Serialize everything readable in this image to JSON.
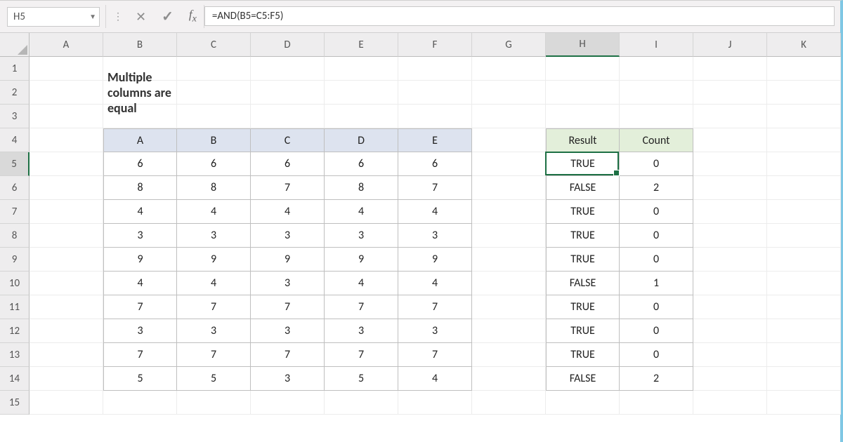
{
  "namebox": {
    "value": "H5"
  },
  "formula": "=AND(B5=C5:F5)",
  "columns": [
    "A",
    "B",
    "C",
    "D",
    "E",
    "F",
    "G",
    "H",
    "I",
    "J",
    "K"
  ],
  "rows": [
    "1",
    "2",
    "3",
    "4",
    "5",
    "6",
    "7",
    "8",
    "9",
    "10",
    "11",
    "12",
    "13",
    "14",
    "15"
  ],
  "active": {
    "col": "H",
    "row": "5"
  },
  "title": "Multiple columns are equal",
  "table1": {
    "headers": [
      "A",
      "B",
      "C",
      "D",
      "E"
    ],
    "rows": [
      [
        "6",
        "6",
        "6",
        "6",
        "6"
      ],
      [
        "8",
        "8",
        "7",
        "8",
        "7"
      ],
      [
        "4",
        "4",
        "4",
        "4",
        "4"
      ],
      [
        "3",
        "3",
        "3",
        "3",
        "3"
      ],
      [
        "9",
        "9",
        "9",
        "9",
        "9"
      ],
      [
        "4",
        "4",
        "3",
        "4",
        "4"
      ],
      [
        "7",
        "7",
        "7",
        "7",
        "7"
      ],
      [
        "3",
        "3",
        "3",
        "3",
        "3"
      ],
      [
        "7",
        "7",
        "7",
        "7",
        "7"
      ],
      [
        "5",
        "5",
        "3",
        "5",
        "4"
      ]
    ]
  },
  "table2": {
    "headers": [
      "Result",
      "Count"
    ],
    "rows": [
      [
        "TRUE",
        "0"
      ],
      [
        "FALSE",
        "2"
      ],
      [
        "TRUE",
        "0"
      ],
      [
        "TRUE",
        "0"
      ],
      [
        "TRUE",
        "0"
      ],
      [
        "FALSE",
        "1"
      ],
      [
        "TRUE",
        "0"
      ],
      [
        "TRUE",
        "0"
      ],
      [
        "TRUE",
        "0"
      ],
      [
        "FALSE",
        "2"
      ]
    ]
  }
}
